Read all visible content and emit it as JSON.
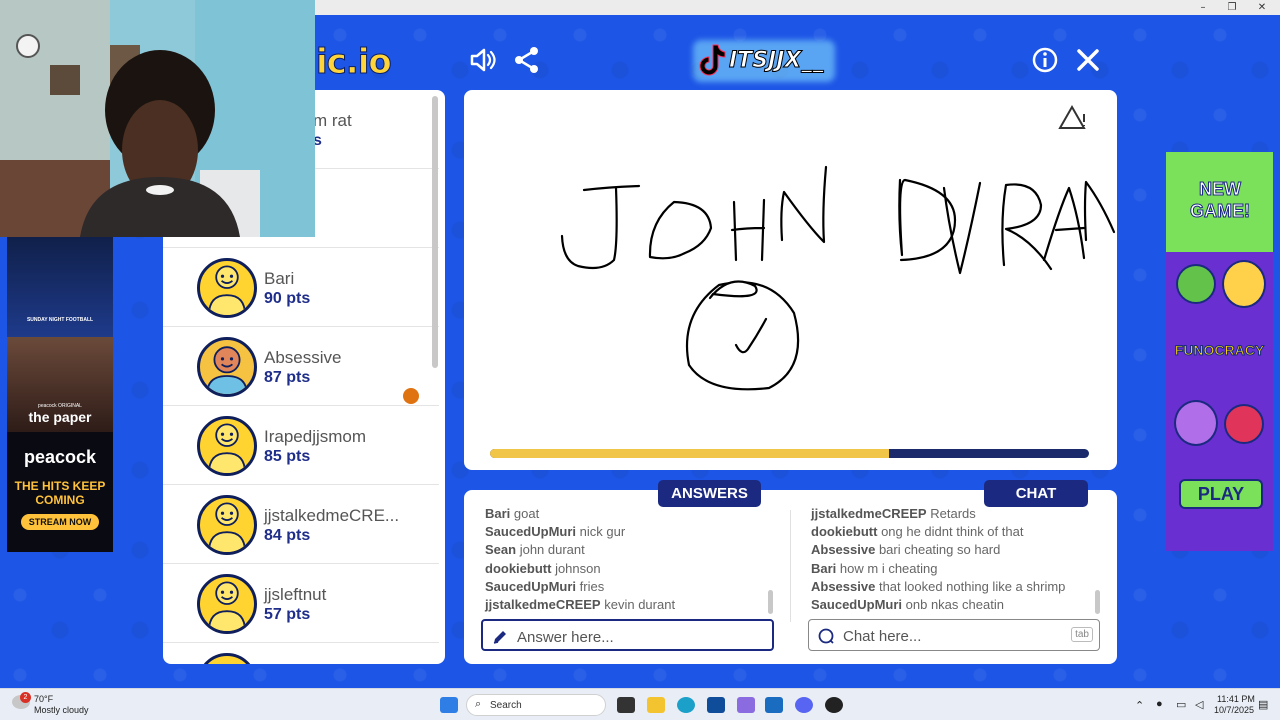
{
  "game": {
    "logo_fragment": "ic.io",
    "streamer_handle": "ITSJJX__",
    "timer_progress": 0.67,
    "canvas_text": "JOHN DURAN"
  },
  "players": [
    {
      "name": "m rat",
      "points": "s"
    },
    {
      "name": "",
      "points": ""
    },
    {
      "name": "Bari",
      "points": "90 pts",
      "drawing": true
    },
    {
      "name": "Absessive",
      "points": "87 pts"
    },
    {
      "name": "Irapedjjsmom",
      "points": "85 pts"
    },
    {
      "name": "jjstalkedmeCRE...",
      "points": "84 pts"
    },
    {
      "name": "jjsleftnut",
      "points": "57 pts"
    }
  ],
  "answers": {
    "tab_label": "ANSWERS",
    "placeholder": "Answer here...",
    "messages": [
      {
        "user": "Bari",
        "text": "goat"
      },
      {
        "user": "SaucedUpMuri",
        "text": "nick gur"
      },
      {
        "user": "Sean",
        "text": "john durant"
      },
      {
        "user": "dookiebutt",
        "text": "johnson"
      },
      {
        "user": "SaucedUpMuri",
        "text": "fries"
      },
      {
        "user": "jjstalkedmeCREEP",
        "text": "kevin durant"
      }
    ]
  },
  "chat": {
    "tab_label": "CHAT",
    "placeholder": "Chat here...",
    "tab_hint": "tab",
    "messages": [
      {
        "user": "jjstalkedmeCREEP",
        "text": "Retards"
      },
      {
        "user": "dookiebutt",
        "text": "ong he didnt think of that"
      },
      {
        "user": "Absessive",
        "text": "bari cheating so hard"
      },
      {
        "user": "Bari",
        "text": "how m i cheating"
      },
      {
        "user": "Absessive",
        "text": "that looked nothing like a shrimp"
      },
      {
        "user": "SaucedUpMuri",
        "text": "onb nkas cheatin"
      }
    ]
  },
  "ad_left": {
    "brand_small": "SUNDAY NIGHT FOOTBALL",
    "show_small": "peacock ORIGINAL",
    "show_title": "the paper",
    "brand": "peacock",
    "tagline": "THE HITS KEEP COMING",
    "cta": "STREAM NOW"
  },
  "ad_right": {
    "headline": "NEW GAME!",
    "brand": "FUNOCRACY",
    "cta": "PLAY"
  },
  "taskbar": {
    "temperature": "70°F",
    "weather": "Mostly cloudy",
    "weather_badge": "2",
    "search_label": "Search",
    "time": "11:41 PM",
    "date": "10/7/2025"
  },
  "colors": {
    "background": "#1d55e6",
    "panel_navy": "#1b2a80",
    "timer_fill": "#f0c548",
    "avatar_yellow": "#ffd431"
  }
}
